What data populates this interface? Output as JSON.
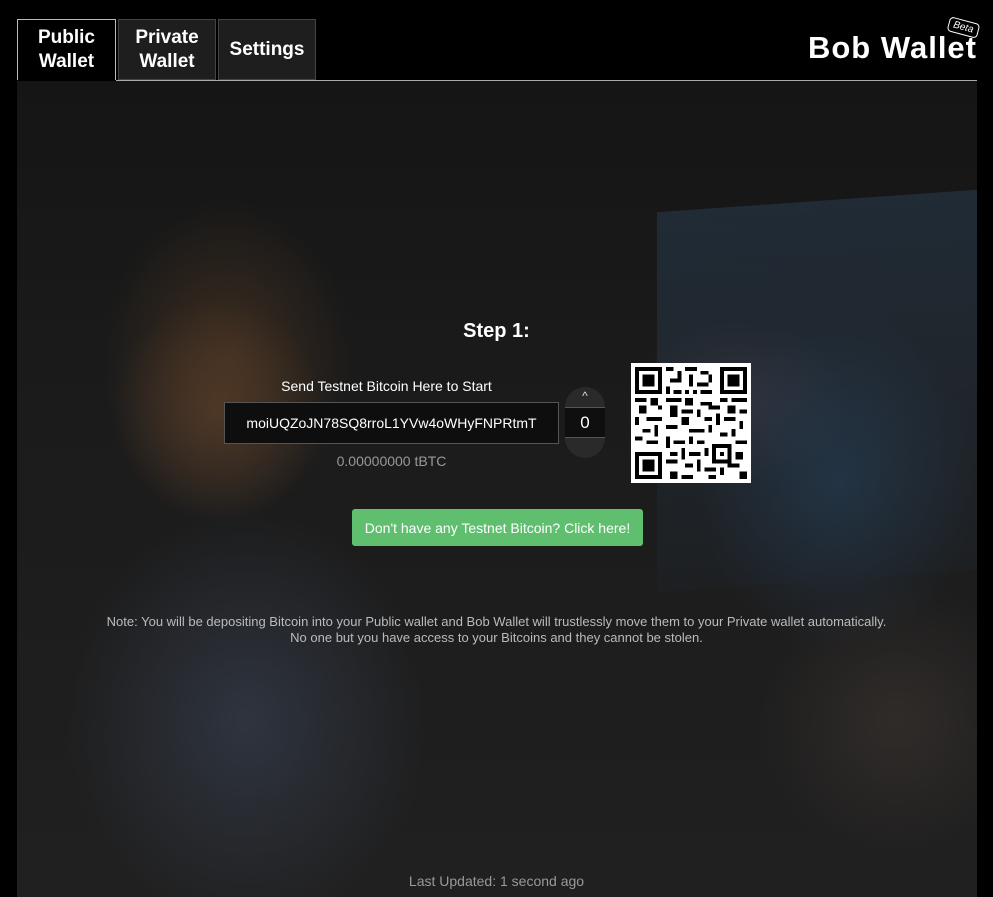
{
  "tabs": [
    {
      "label": "Public\nWallet",
      "active": true
    },
    {
      "label": "Private\nWallet",
      "active": false
    },
    {
      "label": "Settings",
      "active": false
    }
  ],
  "brand": {
    "title": "Bob Wallet",
    "badge": "Beta"
  },
  "step": {
    "title": "Step 1:"
  },
  "deposit": {
    "label": "Send Testnet Bitcoin Here to Start",
    "address": "moiUQZoJN78SQ8rroL1YVw4oWHyFNPRtmT",
    "balance": "0.00000000 tBTC"
  },
  "stepper": {
    "up_symbol": "^",
    "value": "0"
  },
  "cta": {
    "label": "Don't have any Testnet Bitcoin? Click here!"
  },
  "note": {
    "line1": "Note: You will be depositing Bitcoin into your Public wallet and Bob Wallet will trustlessly move them to your Private wallet automatically.",
    "line2": "No one but you have access to your Bitcoins and they cannot be stolen."
  },
  "status": {
    "last_updated": "Last Updated: 1 second ago"
  },
  "colors": {
    "cta": "#5fbf6f",
    "background": "#000000"
  },
  "icons": {
    "qr": "qr-code-icon"
  }
}
